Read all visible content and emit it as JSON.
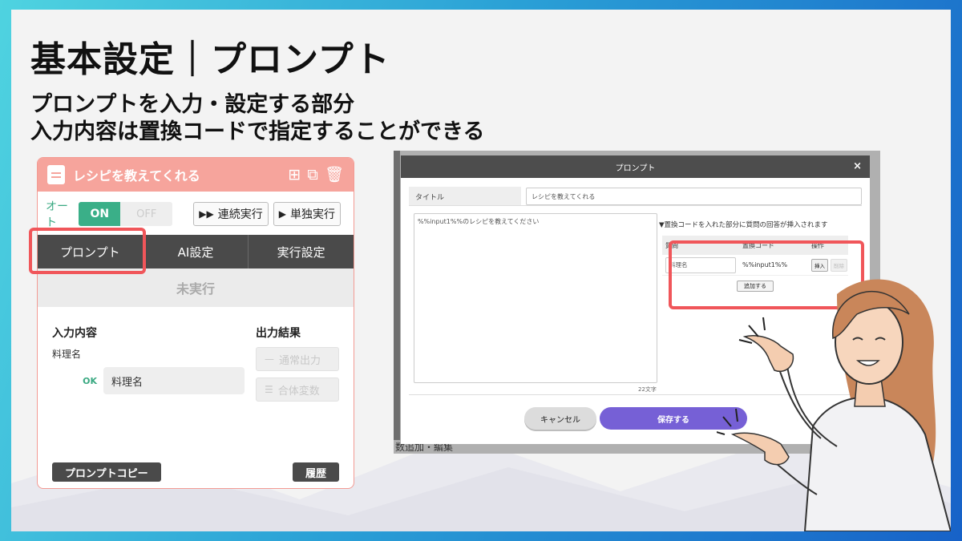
{
  "slide": {
    "title": "基本設定｜プロンプト",
    "subtitle_line1": "プロンプトを入力・設定する部分",
    "subtitle_line2": "入力内容は置換コードで指定することができる"
  },
  "card": {
    "title": "レシピを教えてくれる",
    "auto_label": "オート",
    "toggle_on": "ON",
    "toggle_off": "OFF",
    "run_continuous": "連続実行",
    "run_single": "単独実行",
    "tabs": [
      {
        "label": "プロンプト"
      },
      {
        "label": "AI設定"
      },
      {
        "label": "実行設定"
      }
    ],
    "status": "未実行",
    "input_title": "入力内容",
    "input_field_label": "料理名",
    "input_ok": "OK",
    "input_value": "料理名",
    "output_title": "出力結果",
    "output_normal": "通常出力",
    "output_combined": "合体変数",
    "copy_prompt": "プロンプトコピー",
    "history": "履歴"
  },
  "modal": {
    "header": "プロンプト",
    "close": "×",
    "title_label": "タイトル",
    "title_value": "レシピを教えてくれる",
    "prompt_text": "%%input1%%のレシピを教えてください",
    "char_count": "22文字",
    "replace_note": "▼置換コードを入れた部分に質問の回答が挿入されます",
    "table_headers": [
      "質問",
      "置換コード",
      "操作"
    ],
    "row_question": "料理名",
    "row_code": "%%input1%%",
    "insert_btn": "挿入",
    "delete_btn": "削除",
    "add_btn": "追加する",
    "cancel_btn": "キャンセル",
    "save_btn": "保存する",
    "underlying_text": "数追加・編集"
  },
  "colors": {
    "accent_red": "#f0565a",
    "card_header": "#f6a49c",
    "toggle_green": "#3aaf88",
    "save_purple": "#7660d6"
  },
  "icons": {
    "card_doc": "document-icon",
    "add": "plus-square-icon",
    "copy": "copy-icon",
    "delete": "trash-icon",
    "fast_forward": "fast-forward-icon",
    "play": "play-icon",
    "minus": "minus-icon",
    "doc_lines": "document-lines-icon"
  }
}
